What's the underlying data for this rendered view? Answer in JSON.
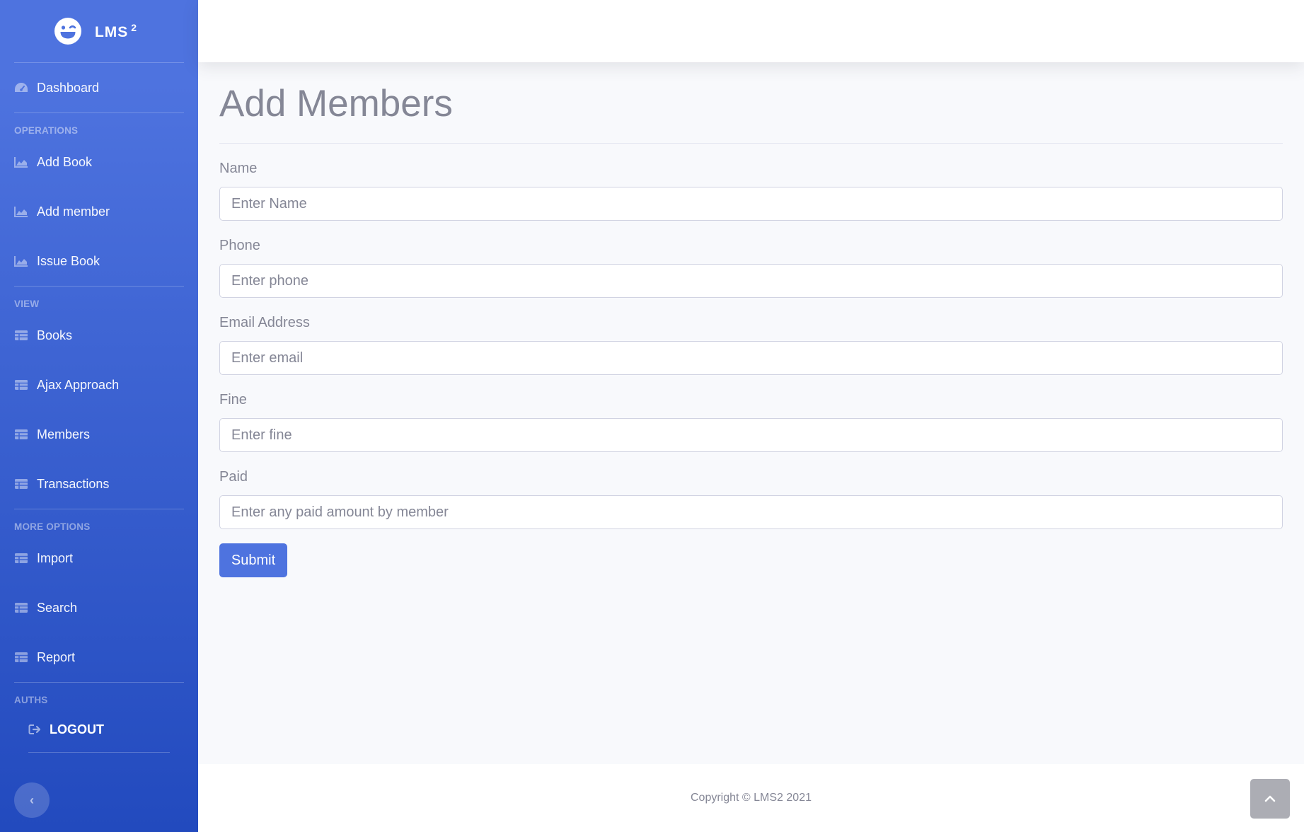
{
  "brand": {
    "name": "LMS",
    "sup": "2"
  },
  "sidebar": {
    "dashboard": "Dashboard",
    "sections": [
      {
        "heading": "OPERATIONS",
        "items": [
          "Add Book",
          "Add member",
          "Issue Book"
        ]
      },
      {
        "heading": "VIEW",
        "items": [
          "Books",
          "Ajax Approach",
          "Members",
          "Transactions"
        ]
      },
      {
        "heading": "MORE OPTIONS",
        "items": [
          "Import",
          "Search",
          "Report"
        ]
      },
      {
        "heading": "AUTHS"
      }
    ],
    "logout": "LOGOUT",
    "toggle_glyph": "‹"
  },
  "main": {
    "title": "Add Members",
    "fields": [
      {
        "label": "Name",
        "placeholder": "Enter Name"
      },
      {
        "label": "Phone",
        "placeholder": "Enter phone"
      },
      {
        "label": "Email Address",
        "placeholder": "Enter email"
      },
      {
        "label": "Fine",
        "placeholder": "Enter fine"
      },
      {
        "label": "Paid",
        "placeholder": "Enter any paid amount by member"
      }
    ],
    "submit_label": "Submit"
  },
  "footer": {
    "copyright": "Copyright © LMS2 2021"
  },
  "icons": {
    "brand": "laugh-wink-icon",
    "dashboard": "tachometer-icon",
    "operations": "chart-area-icon",
    "view": "table-icon",
    "logout": "sign-out-icon",
    "toggle": "chevron-left-icon",
    "scroll_top": "chevron-up-icon"
  },
  "colors": {
    "primary": "#4e73df",
    "sidebar_gradient_end": "#224abe",
    "text_muted": "#858796"
  }
}
